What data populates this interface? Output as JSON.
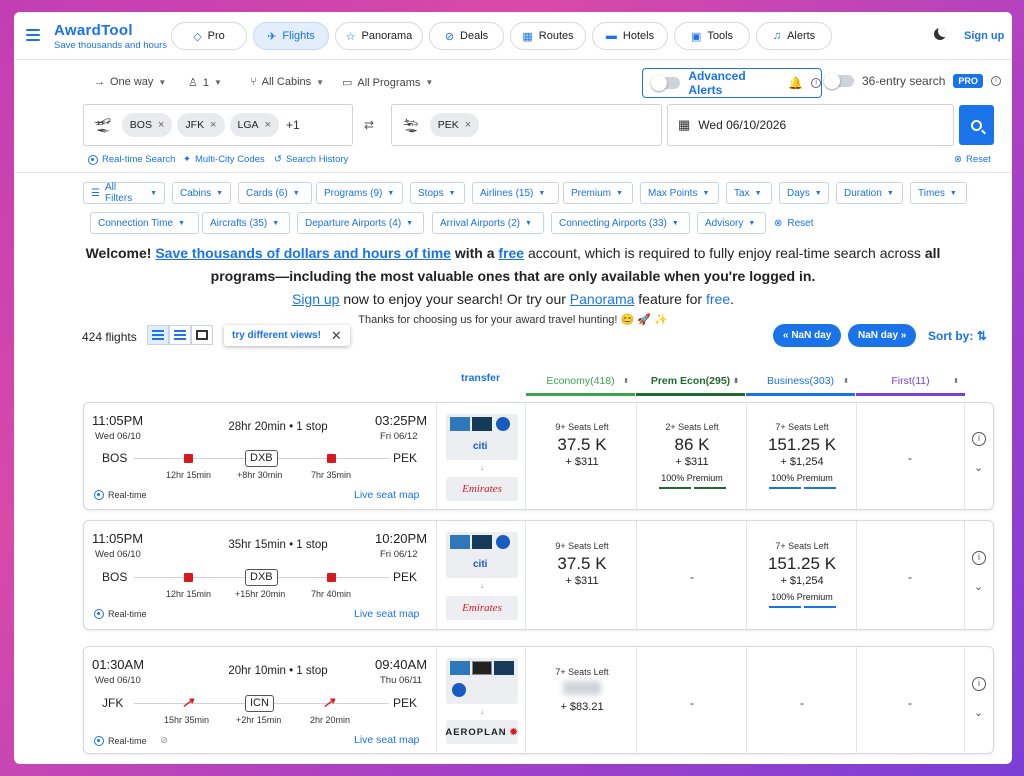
{
  "app": {
    "name": "AwardTool",
    "tagline": "Save thousands and hours",
    "sign_up": "Sign up"
  },
  "nav": [
    {
      "label": "Pro",
      "icon": "diamond-icon"
    },
    {
      "label": "Flights",
      "icon": "plane-icon",
      "active": true
    },
    {
      "label": "Panorama",
      "icon": "star-icon"
    },
    {
      "label": "Deals",
      "icon": "compass-icon"
    },
    {
      "label": "Routes",
      "icon": "calendar-icon"
    },
    {
      "label": "Hotels",
      "icon": "bed-icon"
    },
    {
      "label": "Tools",
      "icon": "briefcase-icon"
    },
    {
      "label": "Alerts",
      "icon": "bell-icon"
    }
  ],
  "search": {
    "trip_type": "One way",
    "passengers": "1",
    "cabins": "All Cabins",
    "programs": "All Programs",
    "advanced_alerts": "Advanced Alerts",
    "entry_search": "36-entry search",
    "pro_badge": "PRO",
    "origins": [
      "BOS",
      "JFK",
      "LGA"
    ],
    "origins_more": "+1",
    "destinations": [
      "PEK"
    ],
    "date": "Wed 06/10/2026",
    "realtime": "Real-time Search",
    "multicity": "Multi-City Codes",
    "history": "Search History",
    "reset": "Reset"
  },
  "filters": {
    "row1": [
      "All Filters",
      "Cabins",
      "Cards (6)",
      "Programs (9)",
      "Stops",
      "Airlines (15)",
      "Premium",
      "Max Points",
      "Tax",
      "Days",
      "Duration",
      "Times"
    ],
    "row2": [
      "Connection Time",
      "Aircrafts (35)",
      "Departure Airports (4)",
      "Arrival Airports (2)",
      "Connecting Airports (33)",
      "Advisory"
    ],
    "reset": "Reset"
  },
  "welcome": {
    "w1": "Welcome! ",
    "l1": "Save thousands of dollars and hours of time",
    "w2": " with a ",
    "l2": "free",
    "w3": " account, which is required to fully enjoy real-time search across ",
    "w4": "all",
    "w5": "programs—including the most valuable ones that are only available when you're logged in.",
    "l3": "Sign up",
    "w6": " now to enjoy your search! Or try our ",
    "l4": "Panorama",
    "w7": " feature for ",
    "l5": "free",
    "w8": ".",
    "thanks": "Thanks for choosing us for your award travel hunting! 😊 🚀 ✨"
  },
  "results": {
    "count": "424 flights",
    "try_views": "try different views!",
    "nan_prev": "« NaN day",
    "nan_next": "NaN day »",
    "sort_by": "Sort by:",
    "transfer": "transfer"
  },
  "columns": [
    {
      "label": "Economy(418)",
      "color": "#3fa34d"
    },
    {
      "label": "Prem Econ(295)",
      "color": "#1f6b2e"
    },
    {
      "label": "Business(303)",
      "color": "#1a73e8"
    },
    {
      "label": "First(11)",
      "color": "#7b3fd6"
    }
  ],
  "flights": [
    {
      "dep_time": "11:05PM",
      "dep_date": "Wed 06/10",
      "arr_time": "03:25PM",
      "arr_date": "Fri 06/12",
      "duration": "28hr 20min • 1 stop",
      "from": "BOS",
      "to": "PEK",
      "via": "DXB",
      "leg1": "12hr 15min",
      "layover": "+8hr 30min",
      "leg2": "7hr 35min",
      "realtime": "Real-time",
      "live": "Live seat map",
      "program": "Emirates",
      "economy": {
        "seats": "9+ Seats Left",
        "points": "37.5 K",
        "fee": "+ $311"
      },
      "premecon": {
        "seats": "2+ Seats Left",
        "points": "86 K",
        "fee": "+ $311",
        "premium": "100% Premium"
      },
      "business": {
        "seats": "7+ Seats Left",
        "points": "151.25 K",
        "fee": "+ $1,254",
        "premium": "100% Premium"
      },
      "first": "-"
    },
    {
      "dep_time": "11:05PM",
      "dep_date": "Wed 06/10",
      "arr_time": "10:20PM",
      "arr_date": "Fri 06/12",
      "duration": "35hr 15min • 1 stop",
      "from": "BOS",
      "to": "PEK",
      "via": "DXB",
      "leg1": "12hr 15min",
      "layover": "+15hr 20min",
      "leg2": "7hr 40min",
      "realtime": "Real-time",
      "live": "Live seat map",
      "program": "Emirates",
      "economy": {
        "seats": "9+ Seats Left",
        "points": "37.5 K",
        "fee": "+ $311"
      },
      "premecon": "-",
      "business": {
        "seats": "7+ Seats Left",
        "points": "151.25 K",
        "fee": "+ $1,254",
        "premium": "100% Premium"
      },
      "first": "-"
    },
    {
      "dep_time": "01:30AM",
      "dep_date": "Wed 06/10",
      "arr_time": "09:40AM",
      "arr_date": "Thu 06/11",
      "duration": "20hr 10min • 1 stop",
      "from": "JFK",
      "to": "PEK",
      "via": "ICN",
      "leg1": "15hr 35min",
      "layover": "+2hr 15min",
      "leg2": "2hr 20min",
      "realtime": "Real-time",
      "live": "Live seat map",
      "program": "AEROPLAN",
      "economy": {
        "seats": "7+ Seats Left",
        "fee": "+ $83.21"
      },
      "premecon": "-",
      "business": "-",
      "first": "-"
    }
  ]
}
